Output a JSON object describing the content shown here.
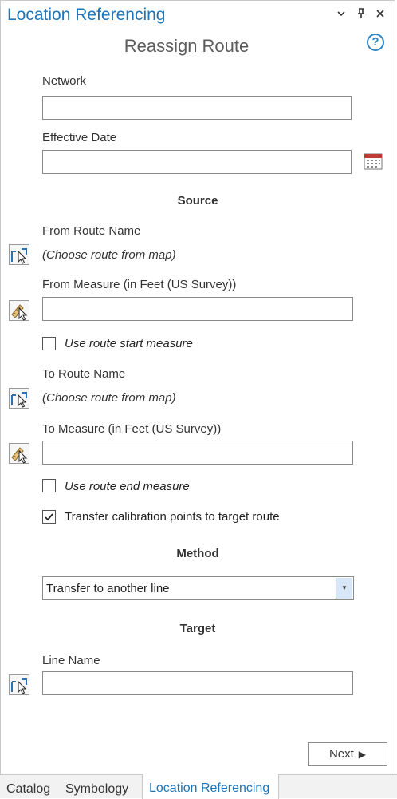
{
  "pane": {
    "title": "Location Referencing",
    "dropdown_icon": "chevron-down-icon",
    "pin_icon": "pin-icon",
    "close_icon": "close-icon"
  },
  "tool": {
    "title": "Reassign Route",
    "help_label": "?"
  },
  "network": {
    "label": "Network",
    "value": ""
  },
  "effective_date": {
    "label": "Effective Date",
    "value": "",
    "calendar_icon": "calendar-icon"
  },
  "source": {
    "heading": "Source",
    "from_route_label": "From Route Name",
    "from_route_value": "(Choose route from map)",
    "from_measure_label": "From Measure (in Feet (US Survey))",
    "from_measure_value": "",
    "use_start_label": "Use route start measure",
    "use_start_checked": false,
    "to_route_label": "To Route Name",
    "to_route_value": "(Choose route from map)",
    "to_measure_label": "To Measure (in Feet (US Survey))",
    "to_measure_value": "",
    "use_end_label": "Use route end measure",
    "use_end_checked": false,
    "transfer_label": "Transfer calibration points to target route",
    "transfer_checked": true
  },
  "method": {
    "heading": "Method",
    "selected": "Transfer to another line"
  },
  "target": {
    "heading": "Target",
    "line_name_label": "Line Name",
    "line_name_value": ""
  },
  "actions": {
    "next_label": "Next",
    "next_arrow": "▶"
  },
  "tabs": [
    {
      "label": "Catalog",
      "active": false
    },
    {
      "label": "Symbology",
      "active": false
    },
    {
      "label": "Location Referencing",
      "active": true
    }
  ],
  "colors": {
    "accent": "#1e74b6",
    "help": "#2e86c9",
    "calendar": "#c23b3b"
  }
}
